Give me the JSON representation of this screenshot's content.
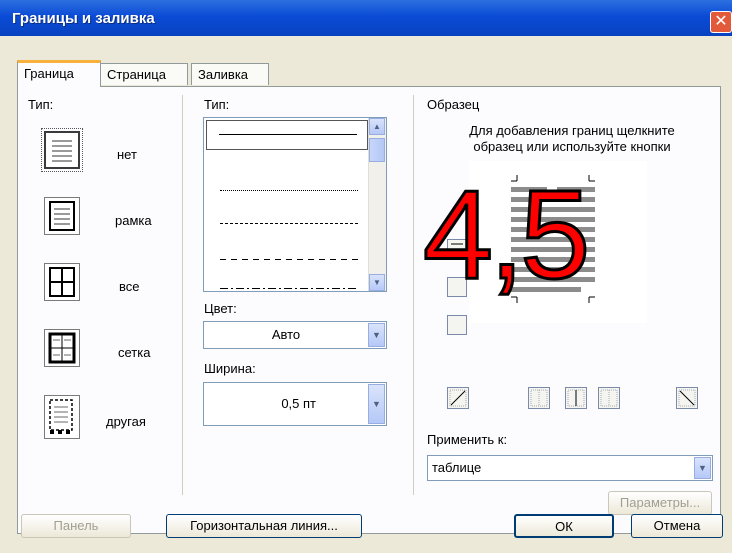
{
  "window": {
    "title": "Границы и заливка",
    "close_glyph": "✕"
  },
  "tabs": [
    {
      "label": "Граница",
      "active": true
    },
    {
      "label": "Страница",
      "active": false
    },
    {
      "label": "Заливка",
      "active": false
    }
  ],
  "setting": {
    "label": "Тип:",
    "presets": [
      {
        "label": "нет",
        "icon": "border-none-icon",
        "selected": true
      },
      {
        "label": "рамка",
        "icon": "border-box-icon",
        "selected": false
      },
      {
        "label": "все",
        "icon": "border-all-icon",
        "selected": false
      },
      {
        "label": "сетка",
        "icon": "border-grid-icon",
        "selected": false
      },
      {
        "label": "другая",
        "icon": "border-custom-icon",
        "selected": false
      }
    ]
  },
  "style": {
    "label": "Тип:",
    "line_styles": [
      "solid",
      "dotted",
      "dashed-small",
      "dashed",
      "dash-dot"
    ],
    "color_label": "Цвет:",
    "color_value": "Авто",
    "width_label": "Ширина:",
    "width_value": "0,5 пт"
  },
  "preview": {
    "label": "Образец",
    "hint_line1": "Для добавления границ щелкните",
    "hint_line2": "образец или используйте кнопки",
    "apply_label": "Применить к:",
    "apply_value": "таблице",
    "options_button": "Параметры..."
  },
  "overlay": {
    "text": "4,5",
    "color": "#ff0000"
  },
  "footer": {
    "toolbar_button": "Панель",
    "hline_button": "Горизонтальная линия...",
    "ok_button": "ОК",
    "cancel_button": "Отмена"
  }
}
